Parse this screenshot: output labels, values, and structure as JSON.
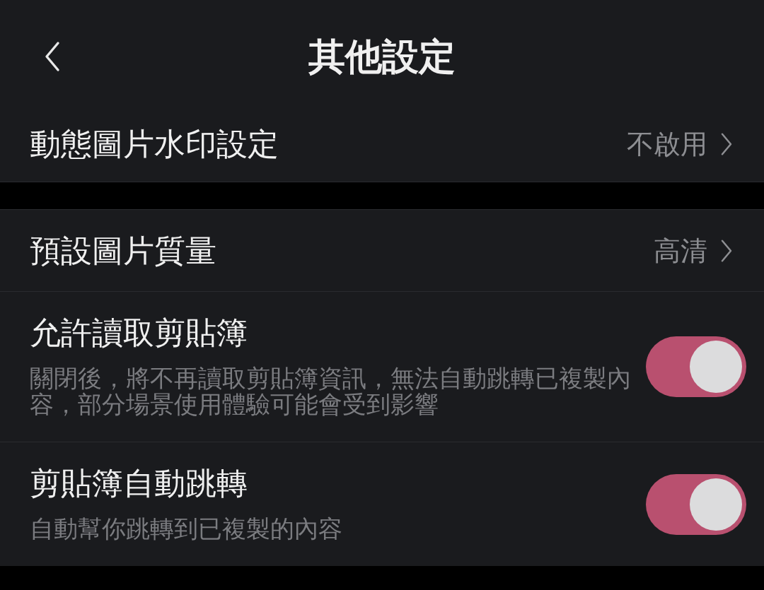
{
  "header": {
    "title": "其他設定"
  },
  "groups": [
    {
      "items": [
        {
          "kind": "link",
          "label": "動態圖片水印設定",
          "value": "不啟用"
        }
      ]
    },
    {
      "items": [
        {
          "kind": "link",
          "label": "預設圖片質量",
          "value": "高清"
        },
        {
          "kind": "toggle",
          "label": "允許讀取剪貼簿",
          "description": "關閉後，將不再讀取剪貼簿資訊，無法自動跳轉已複製內容，部分場景使用體驗可能會受到影響",
          "on": true
        },
        {
          "kind": "toggle",
          "label": "剪貼簿自動跳轉",
          "description": "自動幫你跳轉到已複製的內容",
          "on": true
        }
      ]
    }
  ]
}
